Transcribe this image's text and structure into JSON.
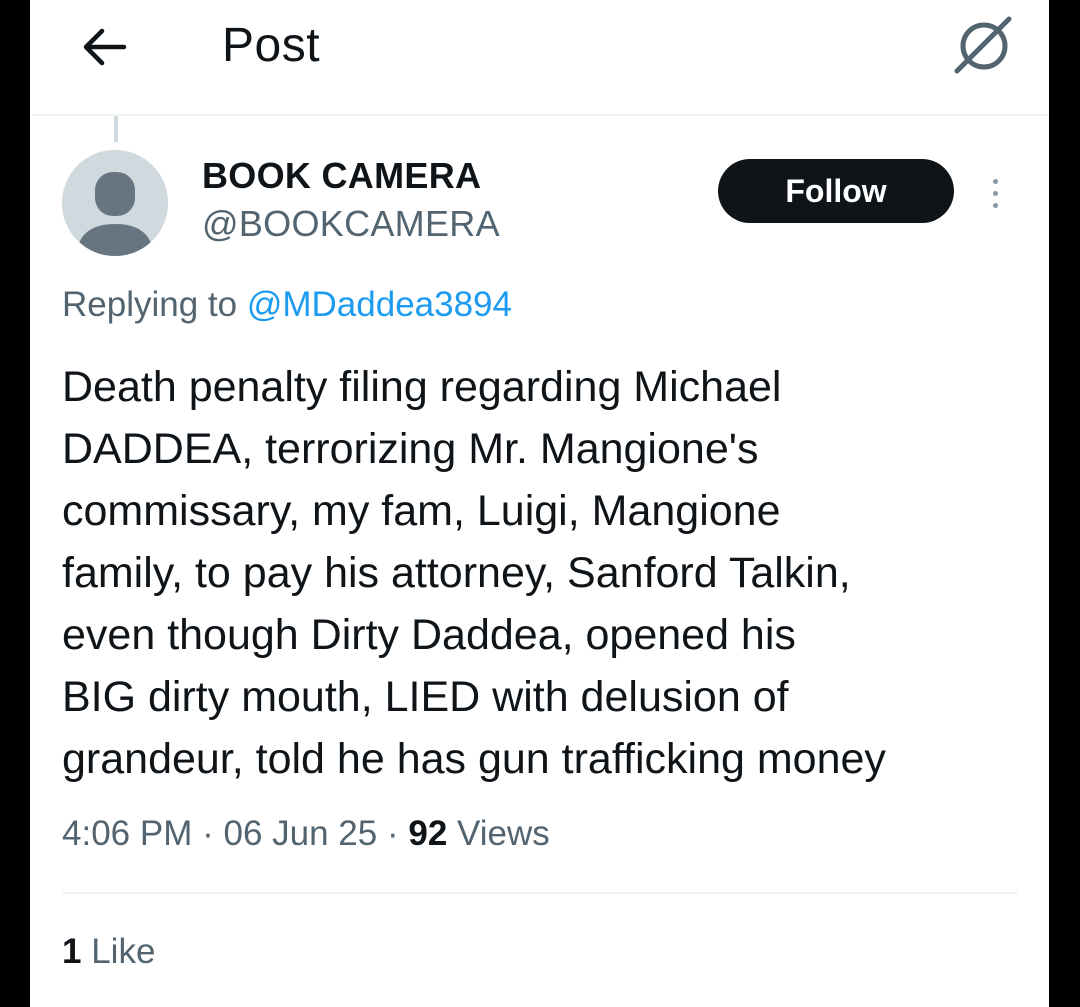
{
  "header": {
    "title": "Post",
    "back_icon": "arrow-left-icon",
    "grok_icon": "grok-icon"
  },
  "post": {
    "author_name": "BOOK CAMERA",
    "author_handle": "@BOOKCAMERA",
    "follow_label": "Follow",
    "replying_prefix": "Replying to",
    "replying_handle": "@MDaddea3894",
    "text_lines": [
      "Death penalty filing regarding Michael",
      "DADDEA, terrorizing Mr. Mangione's",
      "commissary, my fam, Luigi, Mangione",
      "family, to pay his attorney, Sanford Talkin,",
      "even though Dirty Daddea, opened his",
      "BIG dirty mouth, LIED with delusion of",
      "grandeur, told he has gun trafficking money"
    ],
    "time": "4:06 PM",
    "separator": "·",
    "date": "06 Jun 25",
    "views_count": "92",
    "views_label": "Views",
    "likes_count": "1",
    "likes_label": "Like"
  },
  "colors": {
    "text": "#0f1419",
    "secondary": "#536471",
    "link": "#1d9bf0",
    "avatar_bg": "#cfd9de"
  }
}
